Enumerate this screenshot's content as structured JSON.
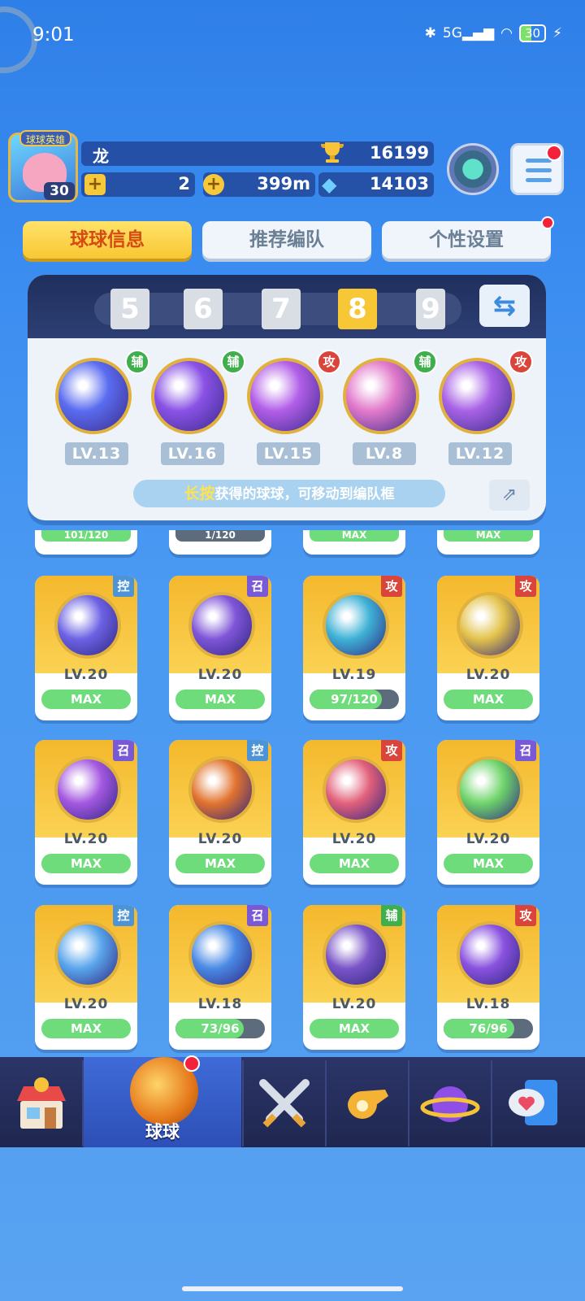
{
  "status": {
    "time": "9:01",
    "network": "5G",
    "battery": "30"
  },
  "profile": {
    "title": "球球英雄",
    "level": "30",
    "name": "龙",
    "trophies": "16199",
    "tickets": "2",
    "coins": "399m",
    "gems": "14103"
  },
  "tabs": [
    {
      "label": "球球信息",
      "active": true
    },
    {
      "label": "推荐编队",
      "active": false
    },
    {
      "label": "个性设置",
      "active": false,
      "badge": true
    }
  ],
  "team": {
    "slots": [
      "5",
      "6",
      "7",
      "8",
      "9"
    ],
    "active_slot": "8",
    "members": [
      {
        "type": "辅",
        "level": "LV.13",
        "icon": "hexagon-shield-icon",
        "color": "#5a6cf0"
      },
      {
        "type": "辅",
        "level": "LV.16",
        "icon": "lightning-card-icon",
        "color": "#8a52e6"
      },
      {
        "type": "攻",
        "level": "LV.15",
        "icon": "infinity-star-icon",
        "color": "#b25ee8"
      },
      {
        "type": "辅",
        "level": "LV.8",
        "icon": "muscle-figure-icon",
        "color": "#e27acb"
      },
      {
        "type": "攻",
        "level": "LV.12",
        "icon": "rocket-icon",
        "color": "#a862e6"
      }
    ],
    "tip_highlight": "长按",
    "tip_text": "获得的球球，可移动到编队框"
  },
  "peek_row": [
    "101/120",
    "1/120",
    "MAX",
    "MAX"
  ],
  "balls": [
    {
      "type": "控",
      "level": "LV.20",
      "progress": "MAX",
      "fill": 1.0,
      "icon": "clock-icon",
      "color": "#6c62e4"
    },
    {
      "type": "召",
      "level": "LV.20",
      "progress": "MAX",
      "fill": 1.0,
      "icon": "ghost-icon",
      "color": "#7f55d8"
    },
    {
      "type": "攻",
      "level": "LV.19",
      "progress": "97/120",
      "fill": 0.81,
      "icon": "tornado-icon",
      "color": "#3fb2d6"
    },
    {
      "type": "攻",
      "level": "LV.20",
      "progress": "MAX",
      "fill": 1.0,
      "icon": "cheese-icon",
      "color": "#e3c24a"
    },
    {
      "type": "召",
      "level": "LV.20",
      "progress": "MAX",
      "fill": 1.0,
      "icon": "heart-orbit-icon",
      "color": "#a458e0"
    },
    {
      "type": "控",
      "level": "LV.20",
      "progress": "MAX",
      "fill": 1.0,
      "icon": "monkey-face-icon",
      "color": "#e2732e"
    },
    {
      "type": "攻",
      "level": "LV.20",
      "progress": "MAX",
      "fill": 1.0,
      "icon": "fist-icon",
      "color": "#e2607a"
    },
    {
      "type": "召",
      "level": "LV.20",
      "progress": "MAX",
      "fill": 1.0,
      "icon": "hexagram-icon",
      "color": "#6fd46a"
    },
    {
      "type": "控",
      "level": "LV.20",
      "progress": "MAX",
      "fill": 1.0,
      "icon": "snowflake-icon",
      "color": "#5aa6ec"
    },
    {
      "type": "召",
      "level": "LV.18",
      "progress": "73/96",
      "fill": 0.76,
      "icon": "ice-spikes-icon",
      "color": "#4a8ae6"
    },
    {
      "type": "辅",
      "level": "LV.20",
      "progress": "MAX",
      "fill": 1.0,
      "icon": "skull-icon",
      "color": "#7a55c8"
    },
    {
      "type": "攻",
      "level": "LV.18",
      "progress": "76/96",
      "fill": 0.79,
      "icon": "crescent-moon-icon",
      "color": "#8a52e0"
    }
  ],
  "type_colors": {
    "辅": "#3fae4c",
    "攻": "#d9453b",
    "控": "#4d94d6",
    "召": "#7a59d6"
  },
  "nav": [
    {
      "label": "",
      "icon": "shop-icon"
    },
    {
      "label": "球球",
      "icon": "ball-icon",
      "active": true,
      "badge": true
    },
    {
      "label": "",
      "icon": "crossed-swords-icon"
    },
    {
      "label": "",
      "icon": "whistle-icon"
    },
    {
      "label": "",
      "icon": "planet-icon"
    },
    {
      "label": "",
      "icon": "chat-heart-icon"
    }
  ]
}
